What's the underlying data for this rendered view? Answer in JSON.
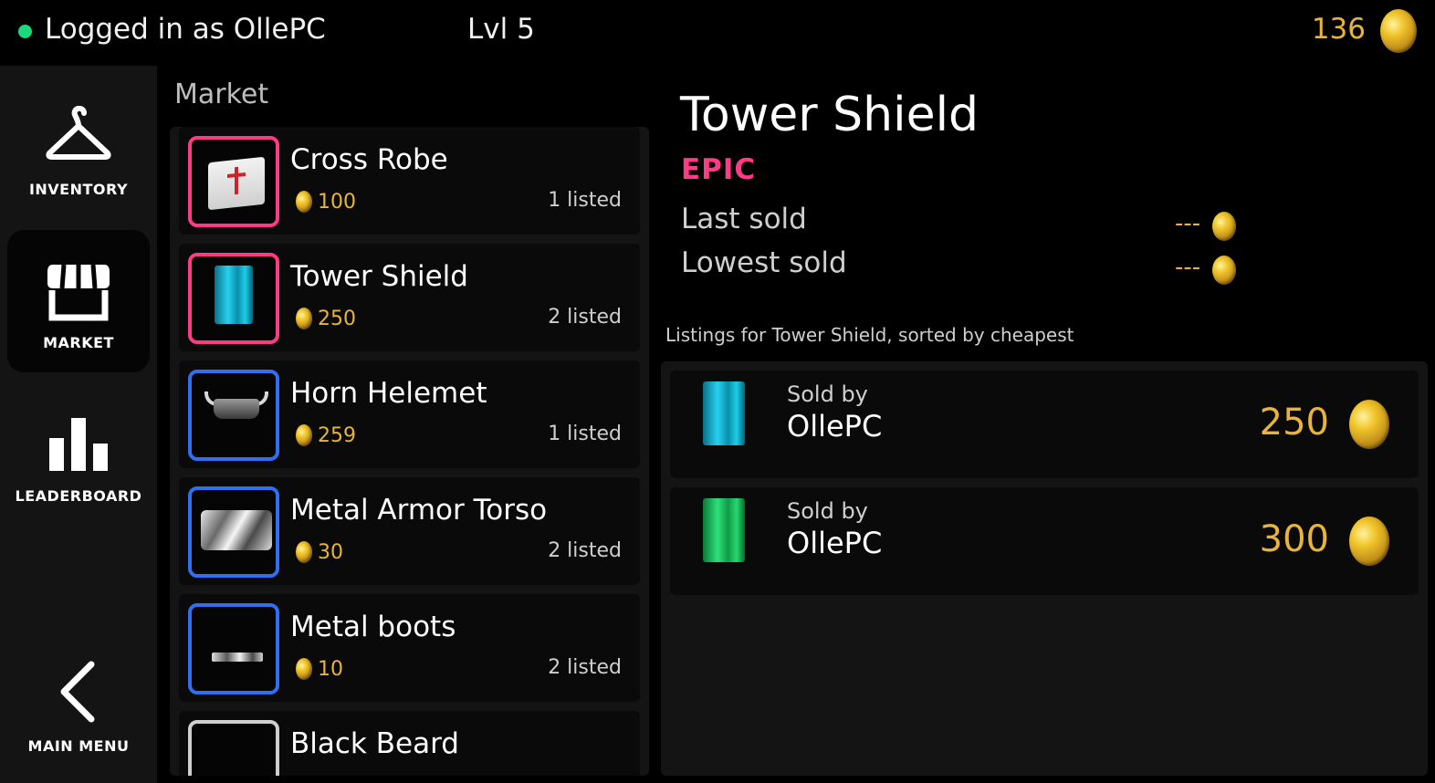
{
  "header": {
    "status_text": "Logged in as OllePC",
    "level": "Lvl 5",
    "gold": "136",
    "status_color": "#19d97a",
    "gold_color": "#e8b53a"
  },
  "sidebar": {
    "items": [
      {
        "label": "INVENTORY",
        "icon": "hanger-icon",
        "active": false
      },
      {
        "label": "MARKET",
        "icon": "storefront-icon",
        "active": true
      },
      {
        "label": "LEADERBOARD",
        "icon": "bar-chart-icon",
        "active": false
      },
      {
        "label": "MAIN MENU",
        "icon": "chevron-left-icon",
        "active": false
      }
    ]
  },
  "market": {
    "title": "Market",
    "items": [
      {
        "name": "Cross Robe",
        "price": "100",
        "listed": "1 listed",
        "rarity_color": "#ff3a86"
      },
      {
        "name": "Tower Shield",
        "price": "250",
        "listed": "2 listed",
        "rarity_color": "#ff3a86"
      },
      {
        "name": "Horn Helemet",
        "price": "259",
        "listed": "1 listed",
        "rarity_color": "#2f6ff0"
      },
      {
        "name": "Metal Armor Torso",
        "price": "30",
        "listed": "2 listed",
        "rarity_color": "#2f6ff0"
      },
      {
        "name": "Metal boots",
        "price": "10",
        "listed": "2 listed",
        "rarity_color": "#2f6ff0"
      },
      {
        "name": "Black Beard",
        "price": "",
        "listed": "",
        "rarity_color": "#cfcfcf"
      }
    ]
  },
  "detail": {
    "title": "Tower Shield",
    "rarity": "EPIC",
    "rarity_color": "#ff3a86",
    "last_sold_label": "Last sold",
    "last_sold_value": "---",
    "lowest_sold_label": "Lowest sold",
    "lowest_sold_value": "---",
    "listings_caption": "Listings for Tower Shield, sorted by cheapest",
    "listings": [
      {
        "sold_by_label": "Sold by",
        "seller": "OllePC",
        "price": "250",
        "variant_color": "#1ccde8"
      },
      {
        "sold_by_label": "Sold by",
        "seller": "OllePC",
        "price": "300",
        "variant_color": "#1fd46a"
      }
    ]
  }
}
